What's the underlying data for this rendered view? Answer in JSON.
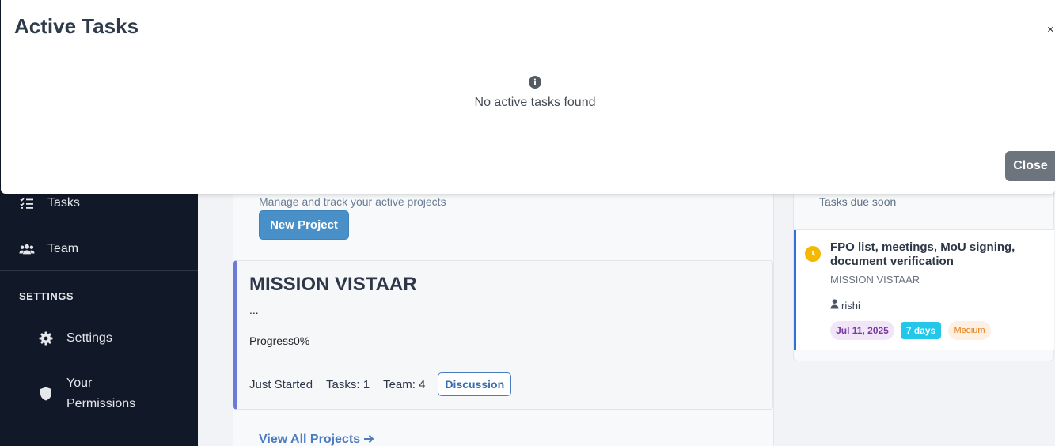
{
  "sidebar": {
    "items": [
      {
        "label": "Tasks",
        "icon": "list-check-icon"
      },
      {
        "label": "Team",
        "icon": "users-icon"
      }
    ],
    "settings_heading": "SETTINGS",
    "settings_items": [
      {
        "label": "Settings",
        "icon": "gear-icon"
      },
      {
        "label": "Your Permissions",
        "icon": "shield-icon"
      }
    ]
  },
  "projects": {
    "subtitle": "Manage and track your active projects",
    "new_project_label": "New Project",
    "items": [
      {
        "name": "MISSION VISTAAR",
        "description": "...",
        "progress_label": "Progress",
        "progress_value": "0%",
        "status": "Just Started",
        "tasks": "Tasks: 1",
        "team": "Team: 4",
        "discussion_label": "Discussion"
      }
    ],
    "view_all_label": "View All Projects"
  },
  "due_soon": {
    "subtitle": "Tasks due soon",
    "tasks": [
      {
        "title": "FPO list, meetings, MoU signing, document verification",
        "project": "MISSION VISTAAR",
        "assignee": "rishi",
        "due_date": "Jul 11, 2025",
        "days_left": "7 days",
        "priority": "Medium"
      }
    ]
  },
  "modal": {
    "title": "Active Tasks",
    "close_x": "×",
    "empty_message": "No active tasks found",
    "close_button": "Close"
  },
  "colors": {
    "sidebar_bg": "#111827",
    "primary_button": "#4a90c8",
    "project_accent": "#6b7bd6",
    "task_accent": "#2f6fd6",
    "days_badge": "#22c7ea",
    "priority_medium": "#e07b15",
    "secondary_button": "#6c757d"
  }
}
